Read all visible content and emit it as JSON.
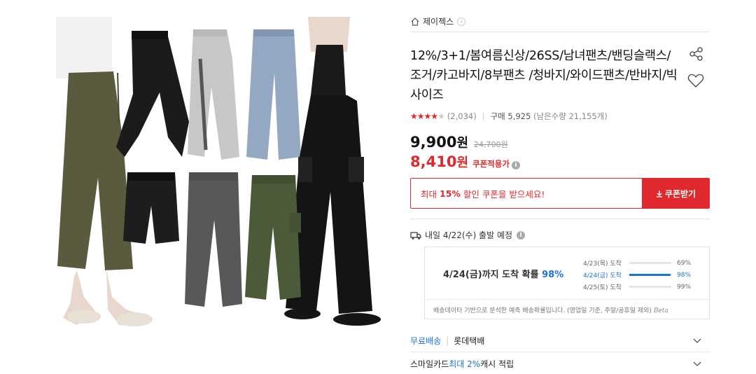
{
  "store": {
    "name": "제이젝스"
  },
  "product": {
    "title": "12%/3+1/봄여름신상/26SS/남녀팬츠/밴딩슬랙스/조거/카고바지/8부팬츠 /청바지/와이드팬츠/반바지/빅사이즈",
    "rating": {
      "stars": 4,
      "review_count": "(2,034)",
      "purchase_label": "구매 5,925",
      "stock": "(남은수량 21,155개)"
    },
    "price": "9,900",
    "price_unit": "원",
    "original_price": "24,700원",
    "coupon_price": "8,410",
    "coupon_unit": "원",
    "coupon_tag": "쿠폰적용가"
  },
  "coupon": {
    "msg_prefix": "최대 ",
    "msg_highlight": "15%",
    "msg_suffix": " 할인 쿠폰을 받으세요!",
    "button": "쿠폰받기"
  },
  "delivery": {
    "label": "내일 4/22(수) 출발 예정",
    "forecast_main_prefix": "4/24(금)까지 도착 확률 ",
    "forecast_main_pct": "98%",
    "rows": [
      {
        "date": "4/23(목) 도착",
        "percent": 69,
        "value": "69%",
        "active": false
      },
      {
        "date": "4/24(금) 도착",
        "percent": 98,
        "value": "98%",
        "active": true
      },
      {
        "date": "4/25(토) 도착",
        "percent": 99,
        "value": "99%",
        "active": false
      }
    ],
    "note": "배송데이터 기반으로 분석한 예측 배송확률입니다. (영업일 기준, 주말/공휴일 제외)",
    "beta": "Beta"
  },
  "shipping": {
    "free": "무료배송",
    "carrier": "롯데택배"
  },
  "smile": {
    "prefix": "스마일카드 ",
    "highlight": "최대 2%",
    "suffix": " 캐시 적립"
  },
  "colors": {
    "accent_red": "#e0292e",
    "accent_blue": "#1e72d6"
  },
  "icons": [
    "home-icon",
    "chevron-right-icon",
    "share-icon",
    "heart-icon",
    "star-icon",
    "info-icon",
    "truck-icon",
    "download-icon",
    "chevron-down-icon"
  ]
}
